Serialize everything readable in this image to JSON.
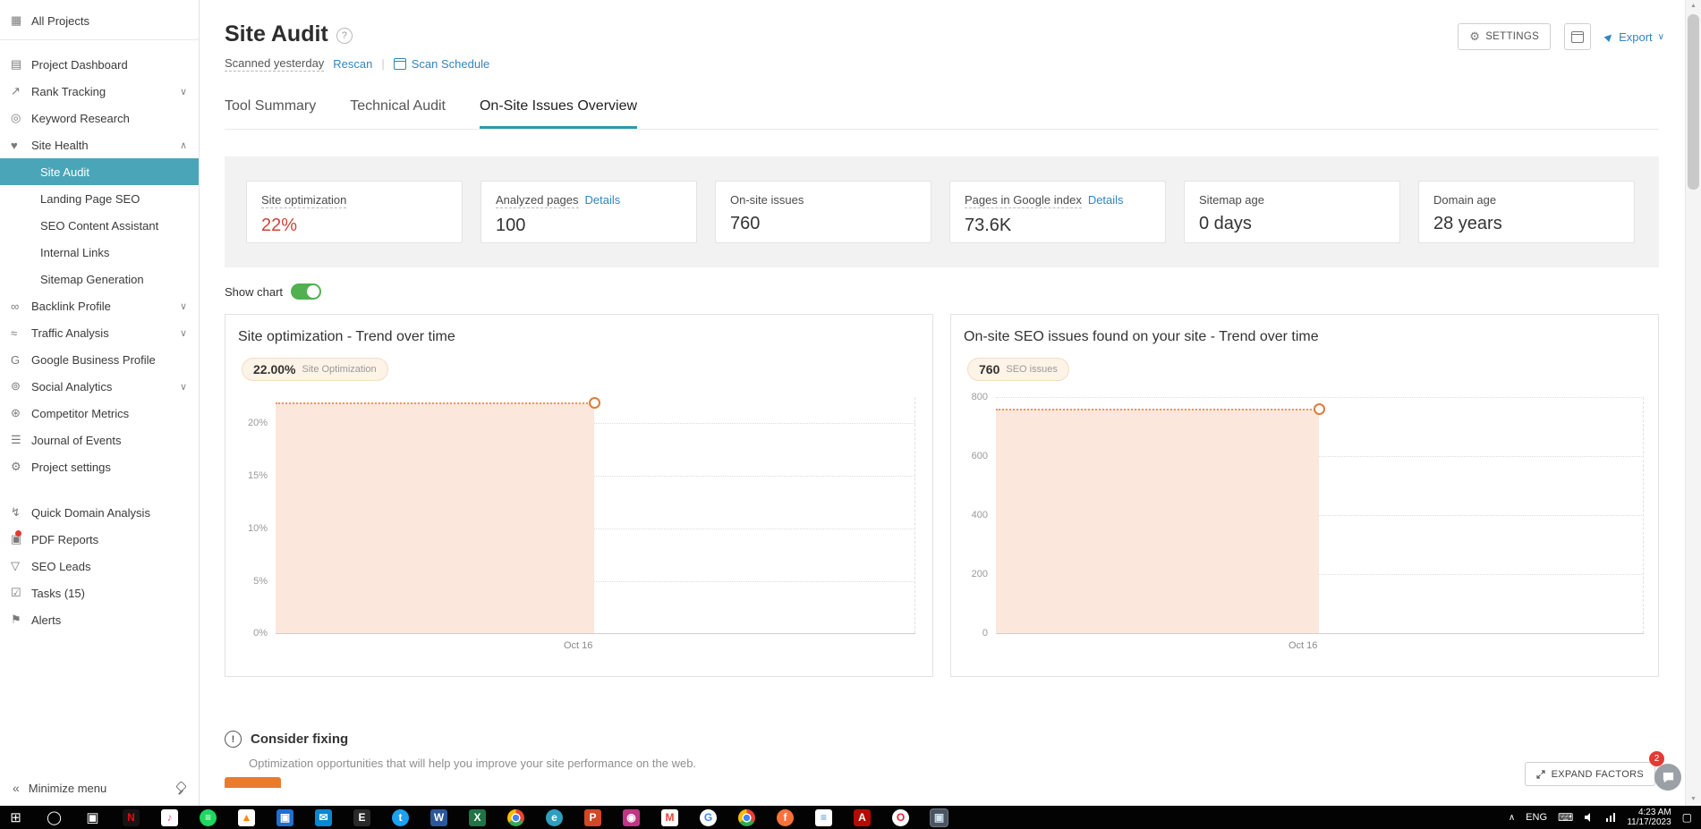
{
  "colors": {
    "accent_teal": "#4aa5b8",
    "tab_underline": "#2f98ad",
    "link_blue": "#2f86c0",
    "value_red": "#c9473a",
    "toggle_green": "#4fb14f",
    "chart_fill": "#fce7dc",
    "chart_line": "#e07b39",
    "band_gray": "#f2f2f2"
  },
  "sidebar": {
    "all_projects": {
      "label": "All Projects",
      "icon": "▦"
    },
    "items": [
      {
        "label": "Project Dashboard",
        "icon": "▤"
      },
      {
        "label": "Rank Tracking",
        "icon": "↗",
        "chevron": "∨"
      },
      {
        "label": "Keyword Research",
        "icon": "◎"
      },
      {
        "label": "Site Health",
        "icon": "♥",
        "chevron": "∧"
      },
      {
        "label": "Site Audit",
        "sub": true,
        "selected": true
      },
      {
        "label": "Landing Page SEO",
        "sub": true
      },
      {
        "label": "SEO Content Assistant",
        "sub": true
      },
      {
        "label": "Internal Links",
        "sub": true
      },
      {
        "label": "Sitemap Generation",
        "sub": true
      },
      {
        "label": "Backlink Profile",
        "icon": "∞",
        "chevron": "∨"
      },
      {
        "label": "Traffic Analysis",
        "icon": "≈",
        "chevron": "∨"
      },
      {
        "label": "Google Business Profile",
        "icon": "G"
      },
      {
        "label": "Social Analytics",
        "icon": "⊚",
        "chevron": "∨"
      },
      {
        "label": "Competitor Metrics",
        "icon": "⊛"
      },
      {
        "label": "Journal of Events",
        "icon": "☰"
      },
      {
        "label": "Project settings",
        "icon": "⚙"
      },
      {
        "label": "Quick Domain Analysis",
        "icon": "↯"
      },
      {
        "label": "PDF Reports",
        "icon": "▣"
      },
      {
        "label": "SEO Leads",
        "icon": "▽"
      },
      {
        "label": "Tasks (15)",
        "icon": "☑"
      },
      {
        "label": "Alerts",
        "icon": "⚑"
      }
    ],
    "collapse_icon": "«",
    "minimize_label": "Minimize menu"
  },
  "header": {
    "title": "Site Audit",
    "help_icon": "?",
    "scanned": "Scanned yesterday",
    "rescan": "Rescan",
    "separator": "|",
    "scan_schedule": "Scan Schedule",
    "settings_label": "SETTINGS",
    "settings_icon": "⚙",
    "export_label": "Export",
    "export_icon": "▶",
    "caret_down": "∨"
  },
  "tabs": [
    {
      "label": "Tool Summary"
    },
    {
      "label": "Technical Audit"
    },
    {
      "label": "On-Site Issues Overview"
    }
  ],
  "stats": [
    {
      "label": "Site optimization",
      "value": "22%"
    },
    {
      "label": "Analyzed pages",
      "link": "Details",
      "value": "100"
    },
    {
      "label": "On-site issues",
      "value": "760"
    },
    {
      "label": "Pages in Google index",
      "link": "Details",
      "value": "73.6K"
    },
    {
      "label": "Sitemap age",
      "value": "0 days"
    },
    {
      "label": "Domain age",
      "value": "28 years"
    }
  ],
  "show_chart": {
    "label": "Show chart",
    "state": "on"
  },
  "charts": [
    {
      "title": "Site optimization - Trend over time",
      "badge_value": "22.00%",
      "badge_label": "Site Optimization",
      "y_ticks": [
        "20%",
        "15%",
        "10%",
        "5%",
        "0%"
      ],
      "x_label": "Oct 16"
    },
    {
      "title": "On-site SEO issues found on your site - Trend over time",
      "badge_value": "760",
      "badge_label": "SEO issues",
      "y_ticks": [
        "800",
        "600",
        "400",
        "200",
        "0"
      ],
      "x_label": "Oct 16"
    }
  ],
  "chart_data": [
    {
      "type": "area",
      "title": "Site optimization - Trend over time",
      "x": [
        "Oct 16"
      ],
      "series": [
        {
          "name": "Site Optimization",
          "values": [
            22.0
          ]
        }
      ],
      "unit": "%",
      "ylim": [
        0,
        22.5
      ],
      "yticks": [
        0,
        5,
        10,
        15,
        20
      ],
      "grid": "horizontal-dotted",
      "legend_position": "badge-top-left",
      "fill_color": "#fce7dc",
      "line_color": "#e07b39"
    },
    {
      "type": "area",
      "title": "On-site SEO issues found on your site - Trend over time",
      "x": [
        "Oct 16"
      ],
      "series": [
        {
          "name": "SEO issues",
          "values": [
            760
          ]
        }
      ],
      "unit": "issues",
      "ylim": [
        0,
        800
      ],
      "yticks": [
        0,
        200,
        400,
        600,
        800
      ],
      "grid": "horizontal-dotted",
      "legend_position": "badge-top-left",
      "fill_color": "#fce7dc",
      "line_color": "#e07b39"
    }
  ],
  "consider_fixing": {
    "warning_icon": "!",
    "title": "Consider fixing",
    "description": "Optimization opportunities that will help you improve your site performance on the web.",
    "expand_button": "EXPAND FACTORS",
    "badge_count": "2"
  },
  "taskbar": {
    "apps": [
      {
        "name": "start",
        "glyph": "⊞",
        "fg": "#ffffff",
        "bg": "transparent",
        "sys": true
      },
      {
        "name": "search",
        "glyph": "◯",
        "fg": "#ffffff",
        "bg": "transparent",
        "sys": true
      },
      {
        "name": "task-view",
        "glyph": "▣",
        "fg": "#ffffff",
        "bg": "transparent",
        "sys": true
      },
      {
        "name": "netflix",
        "glyph": "N",
        "fg": "#e50914",
        "bg": "#141414"
      },
      {
        "name": "music",
        "glyph": "♪",
        "fg": "#f5518c",
        "bg": "#ffffff"
      },
      {
        "name": "spotify",
        "glyph": "≡",
        "fg": "#ffffff",
        "bg": "#1ed760",
        "round": true
      },
      {
        "name": "vlc",
        "glyph": "▲",
        "fg": "#ff8800",
        "bg": "#ffffff"
      },
      {
        "name": "photos",
        "glyph": "▣",
        "fg": "#ffffff",
        "bg": "#1f6fd0"
      },
      {
        "name": "mail",
        "glyph": "✉",
        "fg": "#ffffff",
        "bg": "#0b86d0"
      },
      {
        "name": "epic-games",
        "glyph": "E",
        "fg": "#ffffff",
        "bg": "#2a2a2a"
      },
      {
        "name": "twitter",
        "glyph": "t",
        "fg": "#ffffff",
        "bg": "#1da1f2",
        "round": true
      },
      {
        "name": "word",
        "glyph": "W",
        "fg": "#ffffff",
        "bg": "#2b579a"
      },
      {
        "name": "excel",
        "glyph": "X",
        "fg": "#ffffff",
        "bg": "#217346"
      },
      {
        "name": "chrome",
        "glyph": "",
        "fg": "#ffffff",
        "bg": "chrome",
        "round": true
      },
      {
        "name": "edge",
        "glyph": "e",
        "fg": "#ffffff",
        "bg": "#2f9fc0",
        "round": true
      },
      {
        "name": "powerpoint",
        "glyph": "P",
        "fg": "#ffffff",
        "bg": "#d24726"
      },
      {
        "name": "instagram",
        "glyph": "◉",
        "fg": "#ffffff",
        "bg": "#c13584"
      },
      {
        "name": "gmail",
        "glyph": "M",
        "fg": "#ea4335",
        "bg": "#ffffff"
      },
      {
        "name": "google",
        "glyph": "G",
        "fg": "#4285f4",
        "bg": "#ffffff",
        "round": true
      },
      {
        "name": "chrome",
        "glyph": "",
        "fg": "#ffffff",
        "bg": "chrome",
        "round": true
      },
      {
        "name": "firefox",
        "glyph": "f",
        "fg": "#ffffff",
        "bg": "#ff7139",
        "round": true
      },
      {
        "name": "notes",
        "glyph": "≡",
        "fg": "#4a90d9",
        "bg": "#ffffff"
      },
      {
        "name": "acrobat",
        "glyph": "A",
        "fg": "#ffffff",
        "bg": "#b30b00"
      },
      {
        "name": "opera",
        "glyph": "O",
        "fg": "#ff1b2d",
        "bg": "#ffffff",
        "round": true
      },
      {
        "name": "active-window",
        "glyph": "▣",
        "fg": "#cfe3ef",
        "bg": "#4a5560",
        "active": true
      }
    ],
    "tray": {
      "chevron": "∧",
      "lang": "ENG",
      "time": "4:23 AM",
      "date": "11/17/2023",
      "action_icon": "▢"
    }
  }
}
